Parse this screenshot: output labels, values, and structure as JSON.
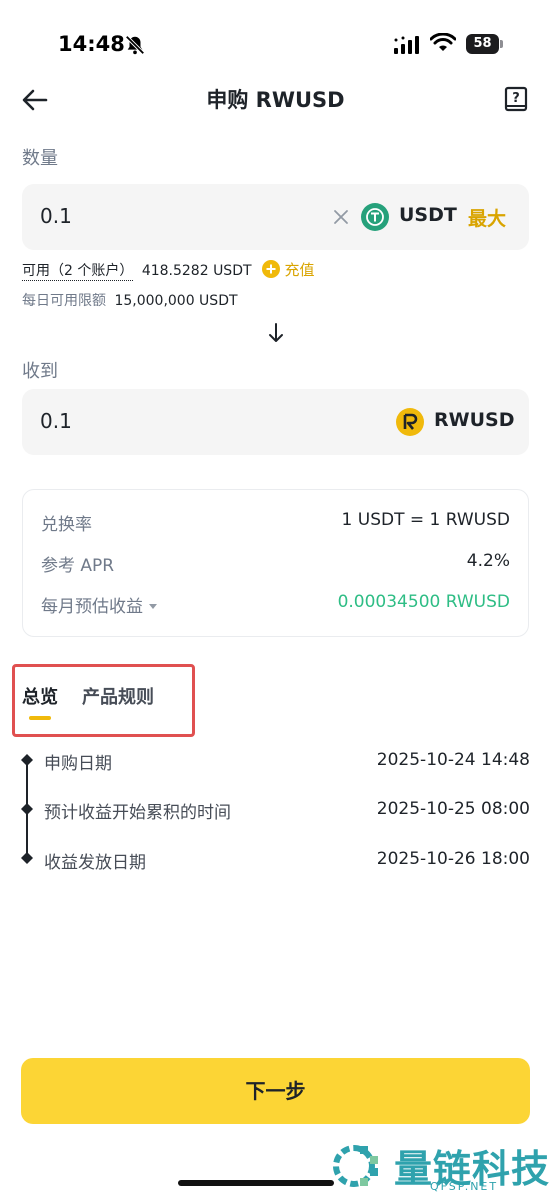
{
  "status_bar": {
    "time": "14:48",
    "battery": "58"
  },
  "header": {
    "title": "申购 RWUSD"
  },
  "amount": {
    "label": "数量",
    "value": "0.1",
    "coin": "USDT",
    "max_label": "最大",
    "available_label": "可用（2 个账户）",
    "available_value": "418.5282 USDT",
    "deposit_label": "充值",
    "daily_limit_label": "每日可用限额",
    "daily_limit_value": "15,000,000 USDT"
  },
  "receive": {
    "label": "收到",
    "value": "0.1",
    "coin": "RWUSD"
  },
  "details": {
    "rate_label": "兑换率",
    "rate_value": "1 USDT = 1 RWUSD",
    "apr_label": "参考 APR",
    "apr_value": "4.2%",
    "monthly_label": "每月预估收益",
    "monthly_value": "0.00034500 RWUSD"
  },
  "tabs": {
    "overview": "总览",
    "rules": "产品规则"
  },
  "timeline": [
    {
      "label": "申购日期",
      "date": "2025-10-24 14:48"
    },
    {
      "label": "预计收益开始累积的时间",
      "date": "2025-10-25 08:00"
    },
    {
      "label": "收益发放日期",
      "date": "2025-10-26 18:00"
    }
  ],
  "next_button": "下一步",
  "watermark": {
    "title": "量链科技",
    "subtitle": "QFSP.NET"
  },
  "colors": {
    "accent": "#fcd535",
    "link": "#d9a400",
    "positive": "#2ebd85",
    "highlight_box": "#e05050"
  },
  "icons": [
    "bell-off-icon",
    "signal-icon",
    "wifi-icon",
    "battery-icon",
    "back-arrow-icon",
    "help-book-icon",
    "clear-icon",
    "usdt-coin-icon",
    "rwusd-coin-icon",
    "plus-circle-icon",
    "arrow-down-icon",
    "caret-down-icon"
  ]
}
